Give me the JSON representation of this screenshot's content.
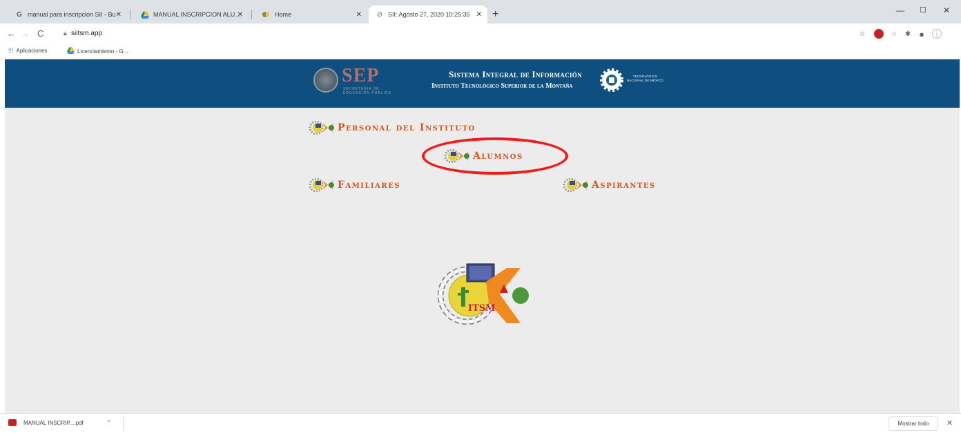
{
  "browser": {
    "tabs": [
      {
        "title": "manual para inscripcion SII - Bu",
        "favicon": "google-icon",
        "active": false
      },
      {
        "title": "MANUAL INSCRIPCION ALUMNC",
        "favicon": "drive-icon",
        "active": false
      },
      {
        "title": "Home",
        "favicon": "itsm-icon",
        "active": false
      },
      {
        "title": "SII: Agosto 27, 2020 10:25:35",
        "favicon": "globe-icon",
        "active": true
      }
    ],
    "new_tab": "+",
    "url": "siitsm.app",
    "bookmarks": [
      {
        "label": "Aplicaciones",
        "icon": "apps-grid-icon"
      },
      {
        "label": "Licenciamiento - G...",
        "icon": "drive-icon"
      }
    ]
  },
  "header": {
    "sep_logo": "SEP",
    "sep_subtitle_line1": "SECRETARÍA DE",
    "sep_subtitle_line2": "EDUCACIÓN PÚBLICA",
    "title": "Sistema Integral de Información",
    "subtitle": "Instituto Tecnológico Superior de la Montaña",
    "tecnm_line1": "TECNOLÓGICO",
    "tecnm_line2": "NACIONAL DE MÉXICO"
  },
  "menu": {
    "personal": "Personal del Instituto",
    "alumnos": "Alumnos",
    "familiares": "Familiares",
    "aspirantes": "Aspirantes"
  },
  "logo_text": "ITSM",
  "downloads": {
    "file": "MANUAL INSCRIP....pdf",
    "show_all": "Mostrar todo"
  },
  "colors": {
    "banner": "#0e4f80",
    "link": "#d9541d",
    "highlight": "#ef1c1c",
    "page_bg": "#ececec"
  }
}
